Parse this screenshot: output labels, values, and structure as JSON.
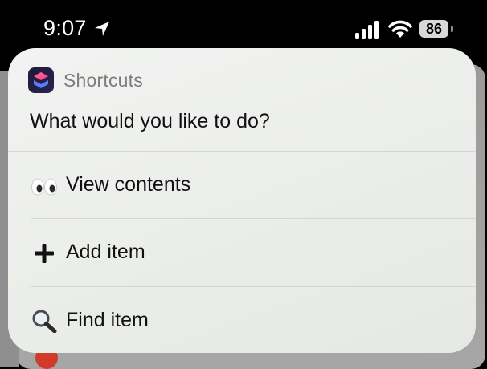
{
  "status_bar": {
    "time": "9:07",
    "battery_level": "86",
    "location_icon": "location-arrow-icon",
    "signal_icon": "cellular-signal-icon",
    "wifi_icon": "wifi-icon"
  },
  "dialog": {
    "app_name": "Shortcuts",
    "app_icon": "shortcuts-app-icon",
    "prompt": "What would you like to do?",
    "options": [
      {
        "icon": "eyes-emoji-icon",
        "label": "View contents"
      },
      {
        "icon": "plus-icon",
        "label": "Add item"
      },
      {
        "icon": "magnifying-glass-icon",
        "label": "Find item"
      }
    ]
  },
  "colors": {
    "card_background": "#eceeeb",
    "secondary_text": "#7c7c7c",
    "primary_text": "#111111",
    "status_bar_background": "#000000"
  }
}
